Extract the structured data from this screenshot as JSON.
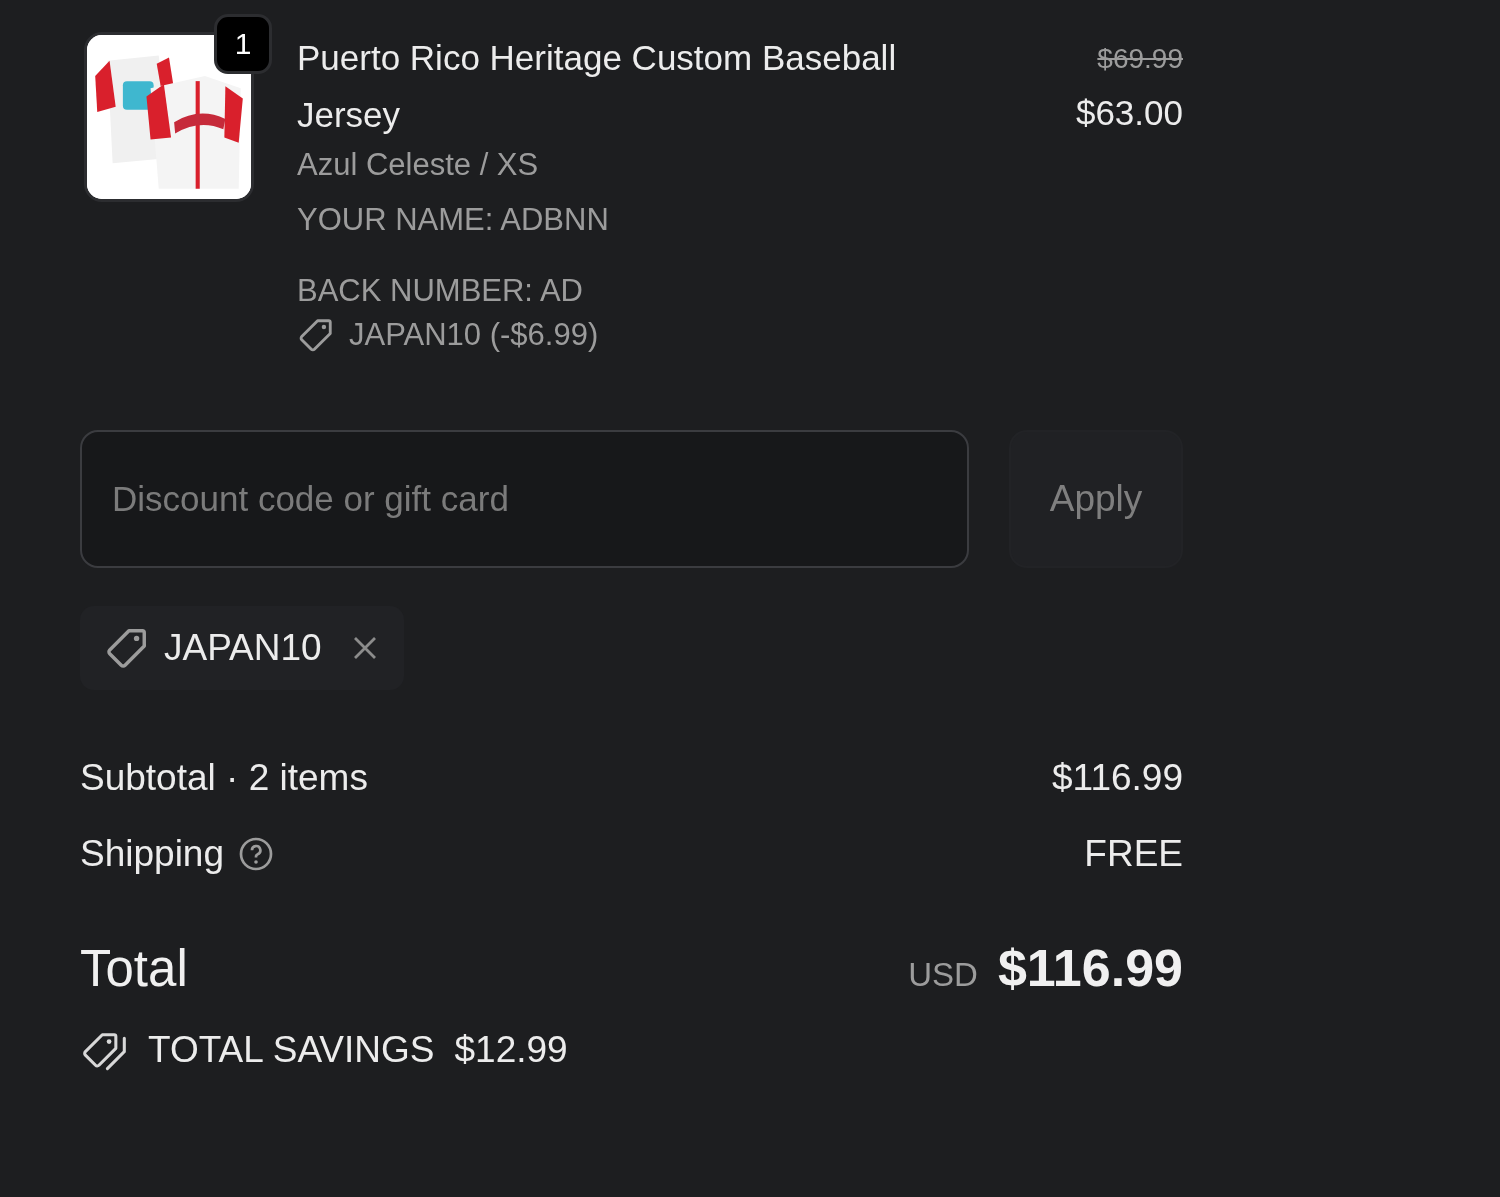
{
  "line_items": [
    {
      "quantity": "1",
      "title": "Puerto Rico Heritage Custom Baseball Jersey",
      "variant": "Azul Celeste / XS",
      "properties": [
        "YOUR NAME: ADBNN",
        "BACK NUMBER: AD"
      ],
      "discount": "JAPAN10 (-$6.99)",
      "compare_price": "$69.99",
      "price": "$63.00"
    }
  ],
  "discount_field": {
    "placeholder": "Discount code or gift card"
  },
  "apply_button": {
    "label": "Apply",
    "disabled": true
  },
  "applied_codes": [
    {
      "code": "JAPAN10"
    }
  ],
  "summary": [
    {
      "label": "Subtotal · 2 items",
      "value": "$116.99",
      "help": false
    },
    {
      "label": "Shipping",
      "value": "FREE",
      "help": true
    }
  ],
  "total": {
    "label": "Total",
    "currency": "USD",
    "value": "$116.99"
  },
  "savings": {
    "label": "TOTAL SAVINGS",
    "value": "$12.99"
  }
}
